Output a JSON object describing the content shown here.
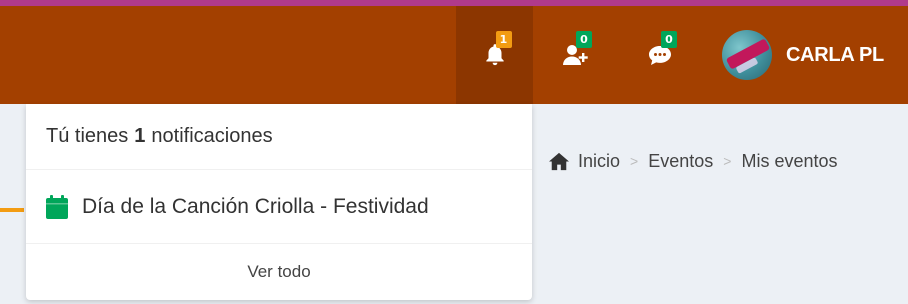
{
  "colors": {
    "navbar": "#a34000",
    "navbar_active": "#8c3600",
    "badge_orange": "#f39c12",
    "badge_green": "#00a65a",
    "calendar_icon": "#00a65a"
  },
  "navbar": {
    "notifications": {
      "icon": "bell-icon",
      "count": "1"
    },
    "friend_requests": {
      "icon": "user-plus-icon",
      "count": "0"
    },
    "messages": {
      "icon": "comments-icon",
      "count": "0"
    },
    "user": {
      "name": "CARLA PL"
    }
  },
  "dropdown": {
    "header_prefix": "Tú tienes",
    "header_count": "1",
    "header_suffix": "notificaciones",
    "items": [
      {
        "icon": "calendar-icon",
        "text": "Día de la Canción Criolla - Festividad"
      }
    ],
    "footer": "Ver todo"
  },
  "breadcrumb": {
    "items": [
      "Inicio",
      "Eventos",
      "Mis eventos"
    ],
    "separator": ">"
  }
}
